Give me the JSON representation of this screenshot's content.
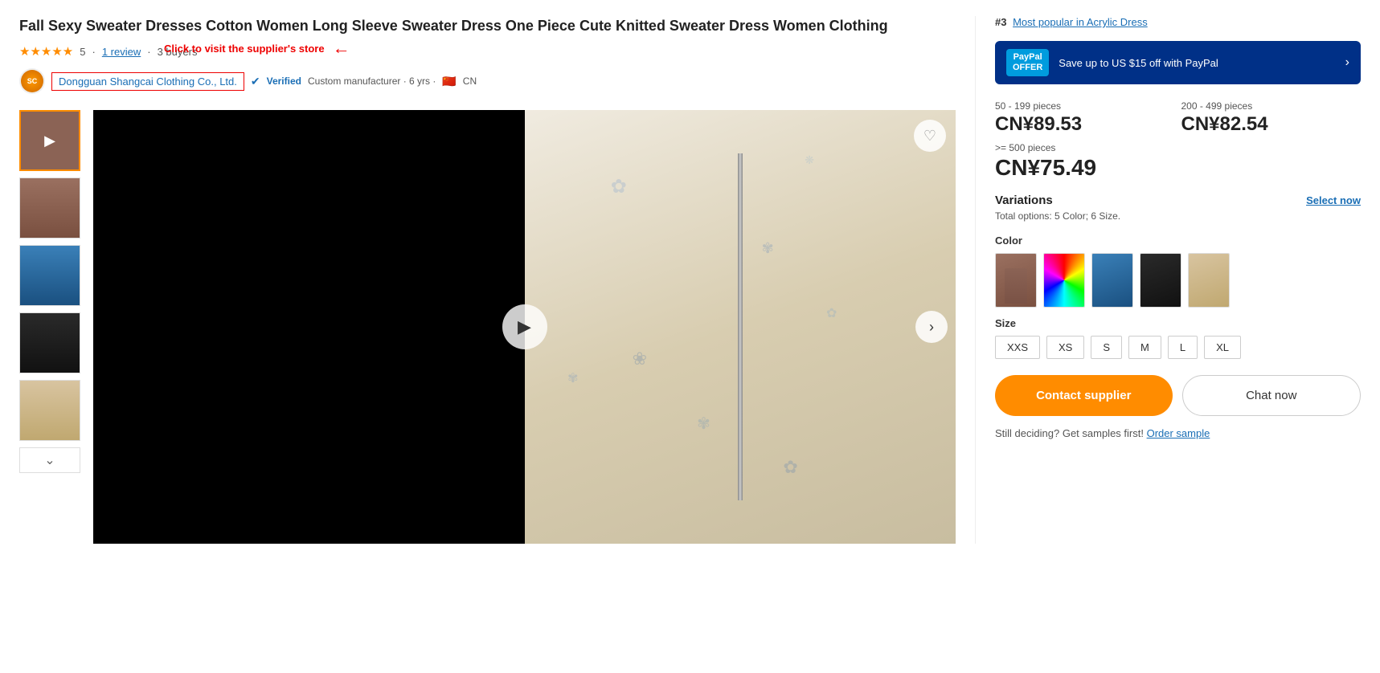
{
  "product": {
    "title": "Fall Sexy Sweater Dresses Cotton Women Long Sleeve Sweater Dress One Piece Cute Knitted Sweater Dress Women Clothing",
    "rating": {
      "stars": 5,
      "star_display": "★★★★★",
      "review_count": "1 review",
      "buyers": "3 buyers"
    },
    "supplier": {
      "name": "Dongguan Shangcai Clothing Co., Ltd.",
      "verified_text": "Verified",
      "meta": "Custom manufacturer · 6 yrs ·",
      "country": "CN",
      "flag": "🇨🇳"
    },
    "annotation": {
      "text": "Click to visit the supplier's store",
      "arrow": "←"
    }
  },
  "pricing": {
    "tier1": {
      "range": "50 - 199 pieces",
      "value": "CN¥89.53"
    },
    "tier2": {
      "range": "200 - 499 pieces",
      "value": "CN¥82.54"
    },
    "tier3": {
      "range": ">= 500 pieces",
      "value": "CN¥75.49"
    }
  },
  "popular_badge": {
    "rank": "#3",
    "link_text": "Most popular in Acrylic Dress"
  },
  "paypal": {
    "offer_line1": "PayPal",
    "offer_line2": "OFFER",
    "description": "Save up to US $15 off with PayPal",
    "arrow": "›"
  },
  "variations": {
    "title": "Variations",
    "subtitle": "Total options: 5 Color; 6 Size.",
    "select_now": "Select now",
    "color_label": "Color",
    "size_label": "Size",
    "sizes": [
      "XXS",
      "XS",
      "S",
      "M",
      "L",
      "XL"
    ],
    "colors": [
      "brown",
      "multicolor",
      "blue",
      "black",
      "beige"
    ]
  },
  "actions": {
    "contact_label": "Contact supplier",
    "chat_label": "Chat now",
    "order_sample_text": "Still deciding? Get samples first!",
    "order_sample_link": "Order sample"
  },
  "thumbnails": [
    {
      "id": 1,
      "color": "brown-video",
      "is_video": true
    },
    {
      "id": 2,
      "color": "brown"
    },
    {
      "id": 3,
      "color": "blue"
    },
    {
      "id": 4,
      "color": "black"
    },
    {
      "id": 5,
      "color": "beige"
    }
  ]
}
